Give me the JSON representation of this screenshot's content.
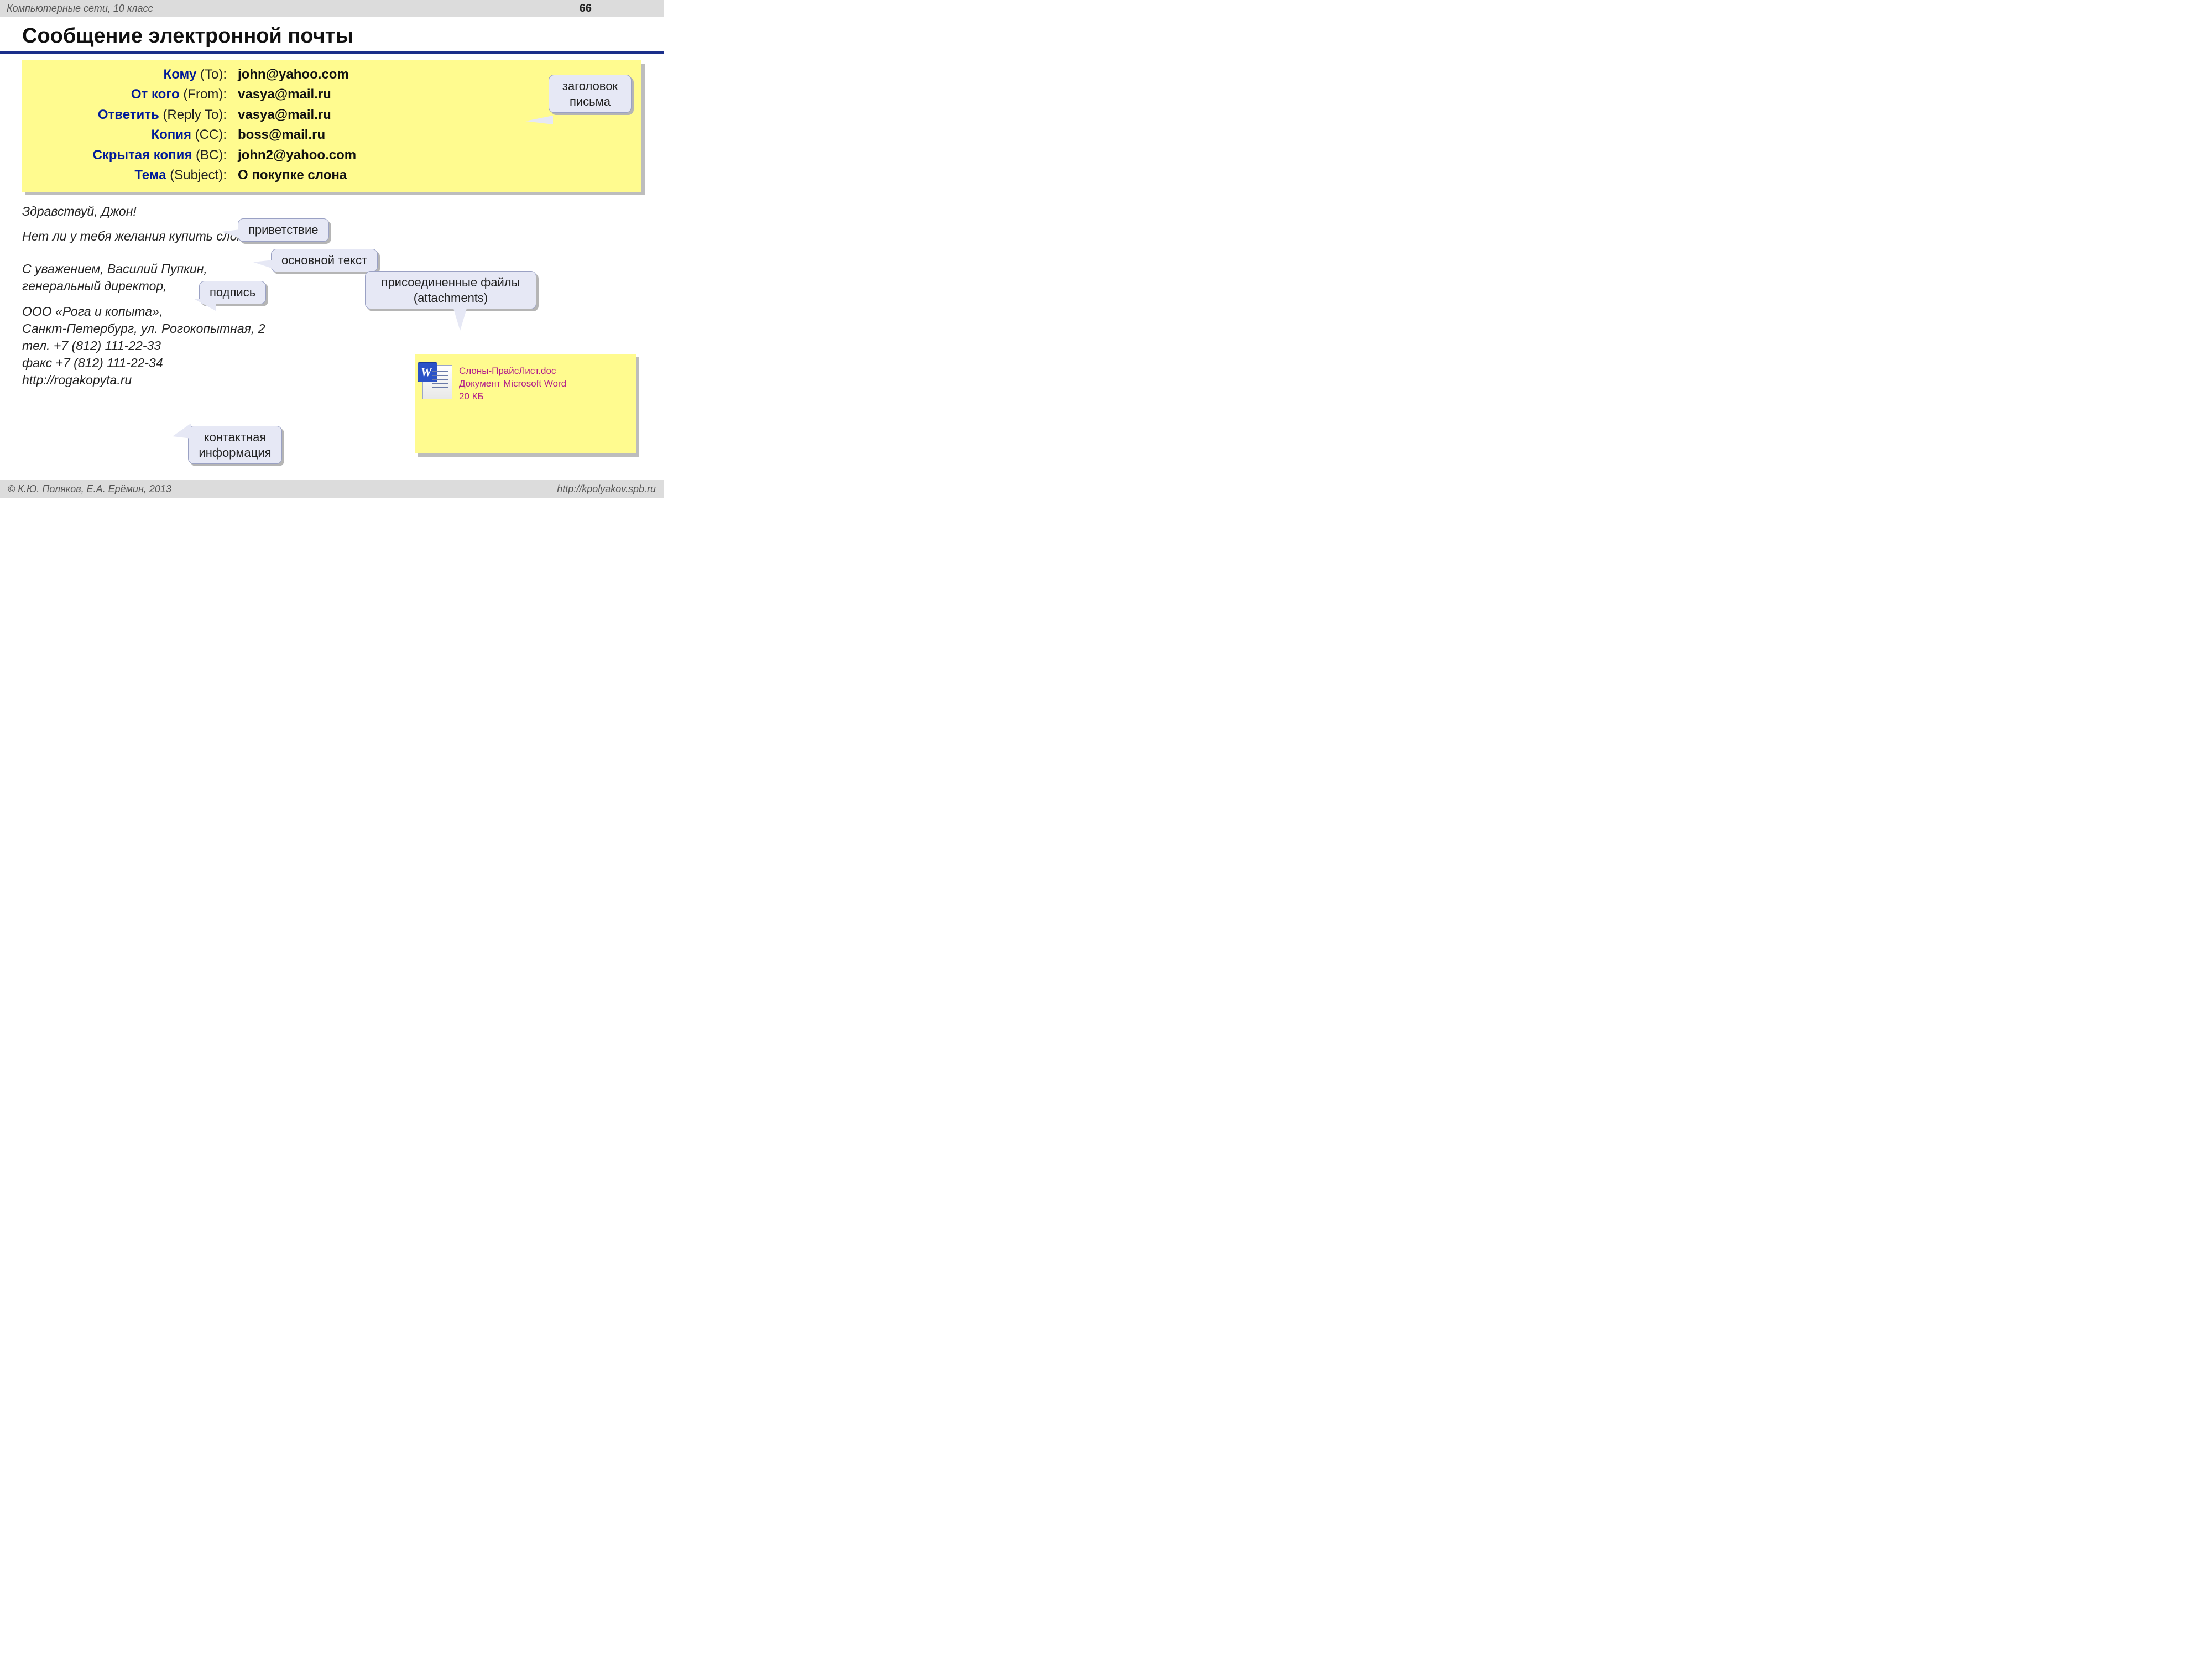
{
  "top": {
    "subject": "Компьютерные сети, 10 класс",
    "page": "66"
  },
  "title": "Сообщение электронной почты",
  "headers": {
    "to_ru": "Кому",
    "to_en": "(To):",
    "to_val": "john@yahoo.com",
    "from_ru": "От кого",
    "from_en": "(From):",
    "from_val": "vasya@mail.ru",
    "reply_ru": "Ответить",
    "reply_en": "(Reply To):",
    "reply_val": "vasya@mail.ru",
    "cc_ru": "Копия",
    "cc_en": "(CC):",
    "cc_val": "boss@mail.ru",
    "bcc_ru": "Скрытая копия",
    "bcc_en": "(BC):",
    "bcc_val": "john2@yahoo.com",
    "subj_ru": "Тема",
    "subj_en": "(Subject):",
    "subj_val": "О покупке слона"
  },
  "callouts": {
    "header": "заголовок\nписьма",
    "greeting": "приветствие",
    "body": "основной текст",
    "signature": "подпись",
    "attachments": "присоединенные файлы\n(attachments)",
    "contact": "контактная\nинформация"
  },
  "body": {
    "greeting": "Здравствуй, Джон!",
    "main": "Нет ли у тебя желания купить слона?",
    "sig1": "С уважением, Василий Пупкин,",
    "sig2": "генеральный директор,",
    "c1": "ООО «Рога и копыта»,",
    "c2": "Санкт-Петербург, ул. Рогокопытная, 2",
    "c3": "тел. +7 (812) 111-22-33",
    "c4": "факс +7 (812) 111-22-34",
    "c5": "http://rogakopyta.ru"
  },
  "attachment": {
    "filename": "Слоны-ПрайсЛист.doc",
    "filetype": "Документ Microsoft Word",
    "filesize": "20 КБ"
  },
  "footer": {
    "left": "© К.Ю. Поляков, Е.А. Ерёмин, 2013",
    "right": "http://kpolyakov.spb.ru"
  }
}
